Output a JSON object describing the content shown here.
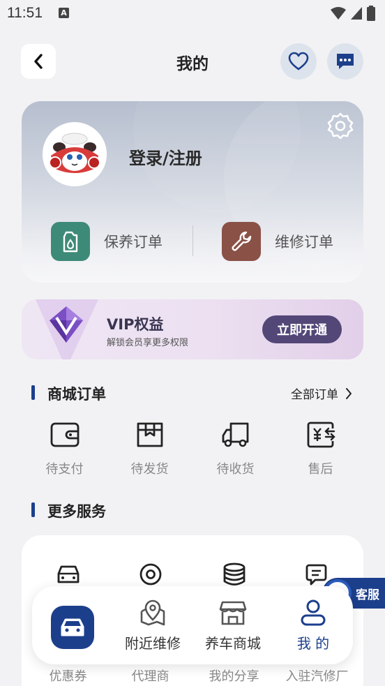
{
  "status_bar": {
    "time": "11:51",
    "notif_icon_letter": "A"
  },
  "header": {
    "title": "我的"
  },
  "profile": {
    "login_text": "登录/注册",
    "orders": [
      {
        "label": "保养订单",
        "icon": "oil-can-icon",
        "color": "#3e8a78"
      },
      {
        "label": "维修订单",
        "icon": "wrench-icon",
        "color": "#8a5147"
      }
    ]
  },
  "vip": {
    "title": "VIP权益",
    "subtitle": "解锁会员享更多权限",
    "button": "立即开通",
    "accent": "#534778"
  },
  "mall": {
    "title": "商城订单",
    "more": "全部订单",
    "items": [
      {
        "label": "待支付",
        "icon": "wallet-icon"
      },
      {
        "label": "待发货",
        "icon": "package-icon"
      },
      {
        "label": "待收货",
        "icon": "truck-icon"
      },
      {
        "label": "售后",
        "icon": "refund-icon"
      }
    ]
  },
  "services": {
    "title": "更多服务",
    "items": [
      {
        "label": "优惠券",
        "icon": "car-icon"
      },
      {
        "label": "代理商",
        "icon": "location-icon"
      },
      {
        "label": "我的分享",
        "icon": "coins-icon"
      },
      {
        "label": "入驻汽修厂",
        "icon": "chat-icon"
      }
    ]
  },
  "customer_service": {
    "label": "客服"
  },
  "bottom_nav": {
    "items": [
      {
        "label": "附近维修",
        "icon": "map-pin-icon"
      },
      {
        "label": "养车商城",
        "icon": "shop-icon"
      },
      {
        "label": "我 的",
        "icon": "user-icon",
        "active": true
      }
    ]
  },
  "colors": {
    "primary": "#1c3f8c",
    "background": "#f2f2f4"
  }
}
